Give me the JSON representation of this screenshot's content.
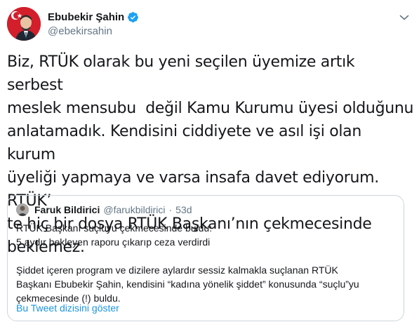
{
  "author": {
    "display_name": "Ebubekir Şahin",
    "handle": "@ebekirsahin",
    "verified": true,
    "avatar_icon": "profile-photo-with-flag"
  },
  "menu_icon": "chevron-down-icon",
  "tweet": {
    "text": "Biz, RTÜK olarak bu yeni seçilen üyemize artık serbest\nmeslek mensubu  değil Kamu Kurumu üyesi olduğunu\nanlatamadık. Kendisini ciddiyete ve asıl işi olan kurum\nüyeliği yapmaya ve varsa insafa davet ediyorum. RTÜK’\nte hiç bir dosya RTÜK Başkanı’nın çekmecesinde\nbeklemez."
  },
  "quoted_tweet": {
    "display_name": "Faruk Bildirici",
    "handle": "@farukbildirici",
    "separator": "·",
    "time": "53d",
    "line1": "RTÜK Başkanı suçluyu çekmecesinde buldu:",
    "line2": "5 aydır bekleyen raporu çıkarıp ceza verdirdi",
    "line3": "Şiddet içeren program ve dizilere aylardır sessiz kalmakla suçlanan RTÜK",
    "line4": "Başkanı Ebubekir Şahin, kendisini “kadına yönelik şiddet” konusunda “suçlu”yu",
    "line5": "çekmecesinde (!) buldu.",
    "show_thread": "Bu Tweet dizisini göster"
  },
  "colors": {
    "link": "#1b95e0",
    "verified": "#1da1f2",
    "secondary_text": "#657786",
    "border": "#ccd6dd"
  }
}
